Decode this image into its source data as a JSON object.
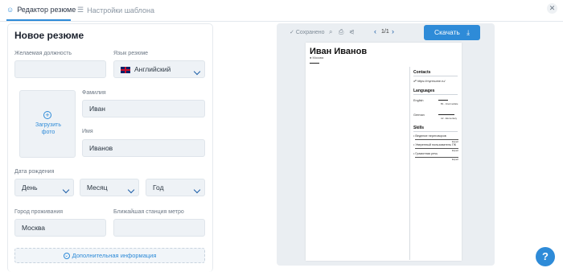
{
  "tabs": [
    {
      "label": "Редактор резюме"
    },
    {
      "label": "Настройки шаблона"
    }
  ],
  "form": {
    "title": "Новое резюме",
    "position_label": "Желаемая должность",
    "position_value": "",
    "language_label": "Язык резюме",
    "language_value": "Английский",
    "photo_label": "Загрузить фото",
    "lastname_label": "Фамилия",
    "lastname_value": "Иван",
    "firstname_label": "Имя",
    "firstname_value": "Иванов",
    "birth_label": "Дата рождения",
    "day_value": "День",
    "month_value": "Месяц",
    "year_value": "Год",
    "city_label": "Город проживания",
    "city_value": "Москва",
    "metro_label": "Ближайшая станция метро",
    "metro_value": "",
    "more_label": "Дополнительная информация"
  },
  "preview": {
    "saved_label": "Сохранено",
    "page_indicator": "1/1",
    "download_label": "Скачать",
    "resume": {
      "name": "Иван Иванов",
      "city": "Москва",
      "contacts_heading": "Contacts",
      "contact_url": "https://myresume.ru/",
      "languages_heading": "Languages",
      "languages": [
        {
          "name": "English",
          "level": "B1 - Intermediate"
        },
        {
          "name": "German",
          "level": "A2 - Elementary"
        }
      ],
      "skills_heading": "Skills",
      "skills": [
        {
          "name": "Ведение переговоров",
          "level": "Expert"
        },
        {
          "name": "Уверенный пользователь ПК",
          "level": "Expert"
        },
        {
          "name": "Грамотная речь",
          "level": "Expert"
        }
      ]
    }
  },
  "help_label": "?",
  "colors": {
    "accent": "#2e8bd8",
    "field_bg": "#eef2f6",
    "preview_bg": "#eaeef2"
  }
}
